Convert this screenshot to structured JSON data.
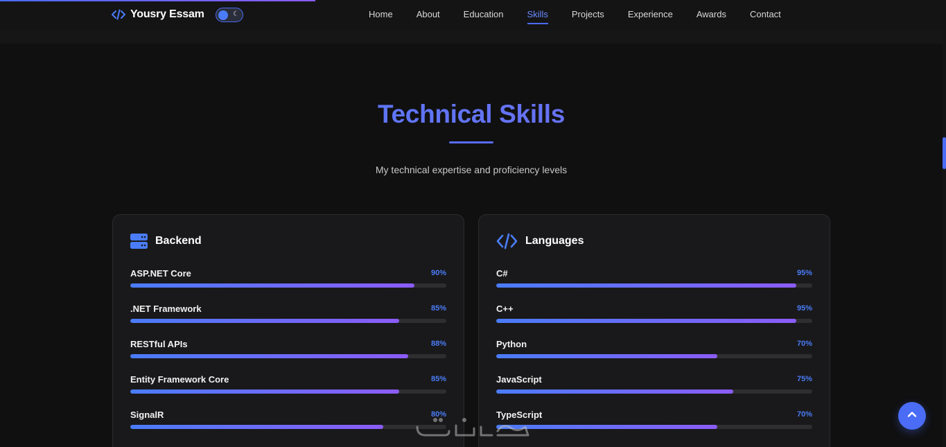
{
  "header": {
    "brand_name": "Yousry Essam",
    "nav": [
      {
        "label": "Home",
        "active": false
      },
      {
        "label": "About",
        "active": false
      },
      {
        "label": "Education",
        "active": false
      },
      {
        "label": "Skills",
        "active": true
      },
      {
        "label": "Projects",
        "active": false
      },
      {
        "label": "Experience",
        "active": false
      },
      {
        "label": "Awards",
        "active": false
      },
      {
        "label": "Contact",
        "active": false
      }
    ],
    "theme_toggle_icon": "moon-icon"
  },
  "section": {
    "title": "Technical Skills",
    "subtitle": "My technical expertise and proficiency levels"
  },
  "cards": [
    {
      "title": "Backend",
      "icon": "server-icon",
      "skills": [
        {
          "name": "ASP.NET Core",
          "percent_label": "90%",
          "value": 90
        },
        {
          "name": ".NET Framework",
          "percent_label": "85%",
          "value": 85
        },
        {
          "name": "RESTful APIs",
          "percent_label": "88%",
          "value": 88
        },
        {
          "name": "Entity Framework Core",
          "percent_label": "85%",
          "value": 85
        },
        {
          "name": "SignalR",
          "percent_label": "80%",
          "value": 80
        }
      ]
    },
    {
      "title": "Languages",
      "icon": "code-icon",
      "skills": [
        {
          "name": "C#",
          "percent_label": "95%",
          "value": 95
        },
        {
          "name": "C++",
          "percent_label": "95%",
          "value": 95
        },
        {
          "name": "Python",
          "percent_label": "70%",
          "value": 70
        },
        {
          "name": "JavaScript",
          "percent_label": "75%",
          "value": 75
        },
        {
          "name": "TypeScript",
          "percent_label": "70%",
          "value": 70
        }
      ]
    }
  ],
  "colors": {
    "accent": "#4a6cf7",
    "accent_purple": "#8b5cf6",
    "background": "#101011",
    "card": "#19191b"
  },
  "back_to_top_icon": "chevron-up-icon"
}
